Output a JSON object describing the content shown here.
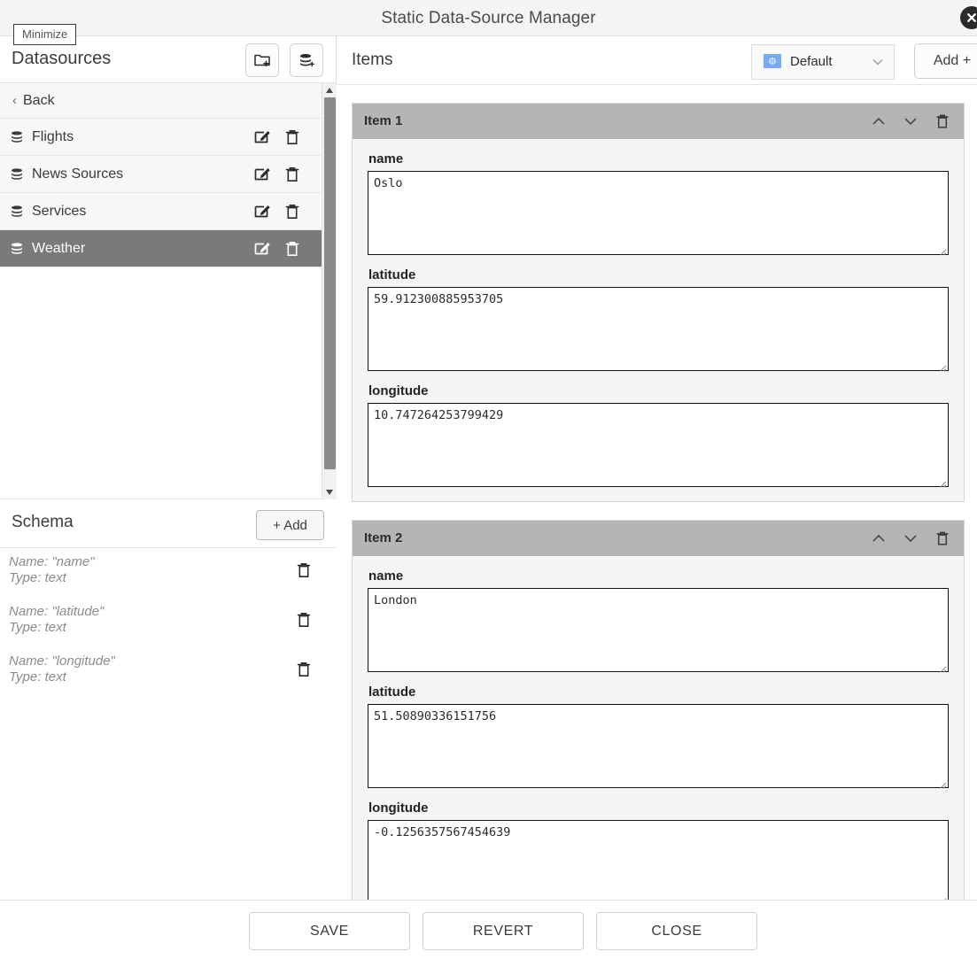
{
  "window": {
    "title": "Static Data-Source Manager",
    "close_icon": "close-circle-icon",
    "tooltip": "Minimize"
  },
  "sidebar": {
    "title": "Datasources",
    "new_folder_icon": "folder-plus-icon",
    "new_datasource_icon": "database-plus-icon",
    "back_label": "Back",
    "back_chevron": "‹",
    "datasources": [
      {
        "label": "Flights",
        "selected": false
      },
      {
        "label": "News Sources",
        "selected": false
      },
      {
        "label": "Services",
        "selected": false
      },
      {
        "label": "Weather",
        "selected": true
      }
    ],
    "schema": {
      "title": "Schema",
      "add_label": "+ Add",
      "fields": [
        {
          "name_line": "Name: \"name\"",
          "type_line": "Type: text"
        },
        {
          "name_line": "Name: \"latitude\"",
          "type_line": "Type: text"
        },
        {
          "name_line": "Name: \"longitude\"",
          "type_line": "Type: text"
        }
      ]
    }
  },
  "items_panel": {
    "title": "Items",
    "locale": {
      "label": "Default",
      "flag_icon": "un-flag-icon",
      "chevron_icon": "chevron-down-icon"
    },
    "add_label": "Add +",
    "items": [
      {
        "header": "Item 1",
        "fields": [
          {
            "label": "name",
            "value": "Oslo"
          },
          {
            "label": "latitude",
            "value": "59.912300885953705"
          },
          {
            "label": "longitude",
            "value": "10.747264253799429"
          }
        ]
      },
      {
        "header": "Item 2",
        "fields": [
          {
            "label": "name",
            "value": "London"
          },
          {
            "label": "latitude",
            "value": "51.50890336151756"
          },
          {
            "label": "longitude",
            "value": "-0.1256357567454639"
          }
        ]
      }
    ]
  },
  "footer": {
    "save_label": "SAVE",
    "revert_label": "REVERT",
    "close_label": "CLOSE"
  },
  "colors": {
    "selected_row": "#7a7a7a",
    "item_header": "#b5b5b5",
    "accent_flag": "#7aaaf0"
  }
}
